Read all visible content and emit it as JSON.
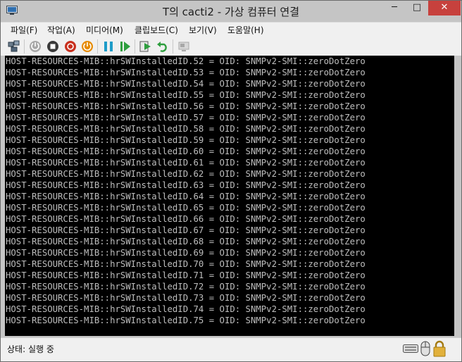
{
  "window": {
    "title": "T의 cacti2 - 가상 컴퓨터 연결"
  },
  "window_controls": {
    "minimize": "─",
    "maximize": "□",
    "close": "✕"
  },
  "menu": [
    {
      "label": "파일(F)"
    },
    {
      "label": "작업(A)"
    },
    {
      "label": "미디어(M)"
    },
    {
      "label": "클립보드(C)"
    },
    {
      "label": "보기(V)"
    },
    {
      "label": "도움말(H)"
    }
  ],
  "toolbar": {
    "buttons": [
      {
        "icon": "ctrl-alt-del-icon"
      },
      {
        "icon": "start-icon",
        "enabled": false
      },
      {
        "icon": "turn-off-icon"
      },
      {
        "icon": "shutdown-icon"
      },
      {
        "icon": "save-state-icon"
      },
      {
        "icon": "pause-icon"
      },
      {
        "icon": "resume-icon"
      },
      {
        "icon": "checkpoint-icon"
      },
      {
        "icon": "revert-icon"
      },
      {
        "icon": "enhanced-session-icon",
        "enabled": false
      }
    ],
    "colors": {
      "gray": "#a8a8a8",
      "red": "#c8301e",
      "orange": "#e68a00",
      "teal": "#1e9bc8",
      "green": "#2e9e3e"
    }
  },
  "console": {
    "lines": [
      "HOST-RESOURCES-MIB::hrSWInstalledID.52 = OID: SNMPv2-SMI::zeroDotZero",
      "HOST-RESOURCES-MIB::hrSWInstalledID.53 = OID: SNMPv2-SMI::zeroDotZero",
      "HOST-RESOURCES-MIB::hrSWInstalledID.54 = OID: SNMPv2-SMI::zeroDotZero",
      "HOST-RESOURCES-MIB::hrSWInstalledID.55 = OID: SNMPv2-SMI::zeroDotZero",
      "HOST-RESOURCES-MIB::hrSWInstalledID.56 = OID: SNMPv2-SMI::zeroDotZero",
      "HOST-RESOURCES-MIB::hrSWInstalledID.57 = OID: SNMPv2-SMI::zeroDotZero",
      "HOST-RESOURCES-MIB::hrSWInstalledID.58 = OID: SNMPv2-SMI::zeroDotZero",
      "HOST-RESOURCES-MIB::hrSWInstalledID.59 = OID: SNMPv2-SMI::zeroDotZero",
      "HOST-RESOURCES-MIB::hrSWInstalledID.60 = OID: SNMPv2-SMI::zeroDotZero",
      "HOST-RESOURCES-MIB::hrSWInstalledID.61 = OID: SNMPv2-SMI::zeroDotZero",
      "HOST-RESOURCES-MIB::hrSWInstalledID.62 = OID: SNMPv2-SMI::zeroDotZero",
      "HOST-RESOURCES-MIB::hrSWInstalledID.63 = OID: SNMPv2-SMI::zeroDotZero",
      "HOST-RESOURCES-MIB::hrSWInstalledID.64 = OID: SNMPv2-SMI::zeroDotZero",
      "HOST-RESOURCES-MIB::hrSWInstalledID.65 = OID: SNMPv2-SMI::zeroDotZero",
      "HOST-RESOURCES-MIB::hrSWInstalledID.66 = OID: SNMPv2-SMI::zeroDotZero",
      "HOST-RESOURCES-MIB::hrSWInstalledID.67 = OID: SNMPv2-SMI::zeroDotZero",
      "HOST-RESOURCES-MIB::hrSWInstalledID.68 = OID: SNMPv2-SMI::zeroDotZero",
      "HOST-RESOURCES-MIB::hrSWInstalledID.69 = OID: SNMPv2-SMI::zeroDotZero",
      "HOST-RESOURCES-MIB::hrSWInstalledID.70 = OID: SNMPv2-SMI::zeroDotZero",
      "HOST-RESOURCES-MIB::hrSWInstalledID.71 = OID: SNMPv2-SMI::zeroDotZero",
      "HOST-RESOURCES-MIB::hrSWInstalledID.72 = OID: SNMPv2-SMI::zeroDotZero",
      "HOST-RESOURCES-MIB::hrSWInstalledID.73 = OID: SNMPv2-SMI::zeroDotZero",
      "HOST-RESOURCES-MIB::hrSWInstalledID.74 = OID: SNMPv2-SMI::zeroDotZero",
      "HOST-RESOURCES-MIB::hrSWInstalledID.75 = OID: SNMPv2-SMI::zeroDotZero"
    ],
    "background": "#000000",
    "text_color": "#bebebe"
  },
  "status": {
    "text": "상태: 실행 중",
    "icons": [
      "keyboard-icon",
      "mouse-icon",
      "lock-icon"
    ]
  }
}
